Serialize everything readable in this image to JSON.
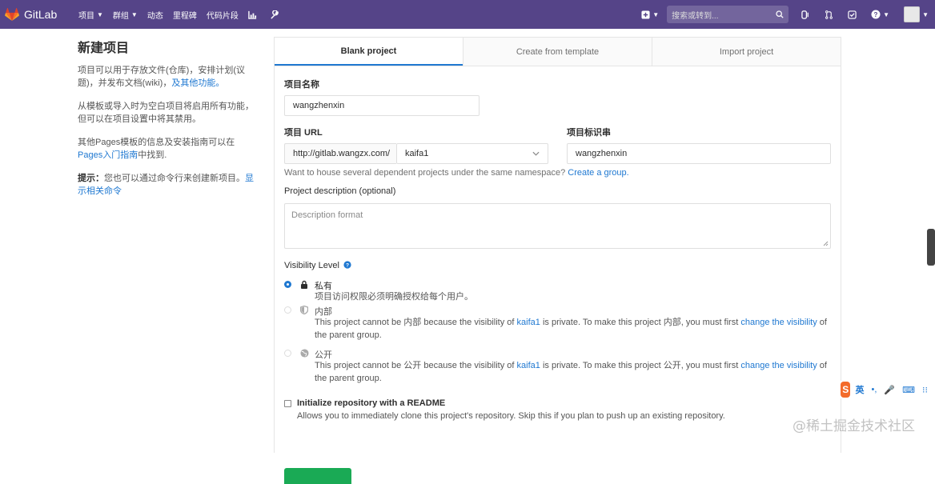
{
  "navbar": {
    "brand": "GitLab",
    "links": [
      "项目",
      "群组",
      "动态",
      "里程碑",
      "代码片段"
    ],
    "search_placeholder": "搜索或转到..."
  },
  "sidebar": {
    "title": "新建项目",
    "p1": "项目可以用于存放文件(仓库)，安排计划(议题)，并发布文档(wiki)，",
    "p1_link": "及其他功能。",
    "p2": "从模板或导入时为空白项目将启用所有功能，但可以在项目设置中将其禁用。",
    "p3": "其他Pages模板的信息及安装指南可以在",
    "p3_link": "Pages入门指南",
    "p3_tail": "中找到.",
    "p4_strong": "提示：",
    "p4": "您也可以通过命令行来创建新项目。",
    "p4_link": "显示相关命令"
  },
  "tabs": [
    "Blank project",
    "Create from template",
    "Import project"
  ],
  "form": {
    "name_label": "项目名称",
    "name_value": "wangzhenxin",
    "url_label": "项目 URL",
    "url_prefix": "http://gitlab.wangzx.com/",
    "namespace_value": "kaifa1",
    "slug_label": "项目标识串",
    "slug_value": "wangzhenxin",
    "group_hint": "Want to house several dependent projects under the same namespace?",
    "group_link": "Create a group.",
    "desc_label": "Project description (optional)",
    "desc_placeholder": "Description format",
    "vis_label": "Visibility Level",
    "private_title": "私有",
    "private_desc": "项目访问权限必须明确授权给每个用户。",
    "internal_title": "内部",
    "internal_desc_1": "This project cannot be 内部 because the visibility of",
    "internal_group": "kaifa1",
    "internal_desc_2": "is private. To make this project 内部, you must first",
    "internal_link": "change the visibility",
    "internal_desc_3": "of the parent group.",
    "public_title": "公开",
    "public_desc_1": "This project cannot be 公开 because the visibility of",
    "public_group": "kaifa1",
    "public_desc_2": "is private. To make this project 公开, you must first",
    "public_link": "change the visibility",
    "public_desc_3": "of the parent group.",
    "readme_label": "Initialize repository with a README",
    "readme_desc": "Allows you to immediately clone this project's repository. Skip this if you plan to push up an existing repository."
  },
  "ime": [
    "英",
    "•,",
    "🎤",
    "⌨",
    "⁝⁝"
  ],
  "watermark": "@稀土掘金技术社区",
  "colors": {
    "navbar": "#554488",
    "link": "#1f78d1",
    "button_green": "#1aaa55"
  }
}
